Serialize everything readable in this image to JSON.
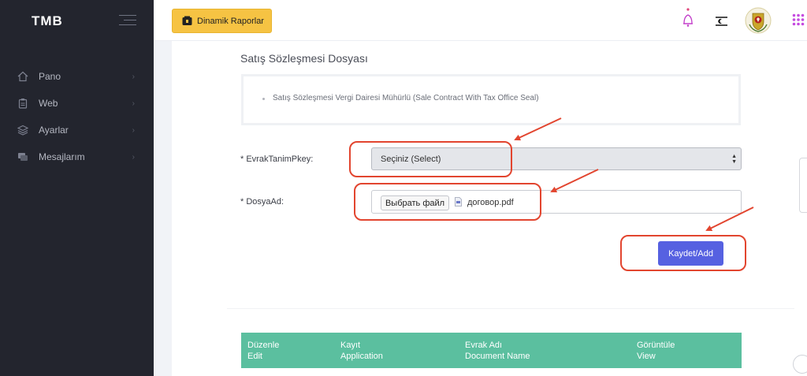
{
  "sidebar": {
    "logo": "TMB",
    "items": [
      {
        "label": "Pano",
        "icon": "home-icon"
      },
      {
        "label": "Web",
        "icon": "clipboard-icon"
      },
      {
        "label": "Ayarlar",
        "icon": "layers-icon"
      },
      {
        "label": "Mesajlarım",
        "icon": "chat-icon"
      }
    ]
  },
  "header": {
    "report_button": "Dinamik Raporlar",
    "icons": [
      "bell-icon",
      "flag-icon",
      "emblem-icon",
      "apps-grid-icon"
    ]
  },
  "form": {
    "section_title": "Satış Sözleşmesi Dosyası",
    "note": "Satış Sözleşmesi Vergi Dairesi Mühürlü (Sale Contract With Tax Office Seal)",
    "evrak_label": "* EvrakTanimPkey:",
    "select_value": "Seçiniz (Select)",
    "dosya_label": "* DosyaAd:",
    "file_button": "Выбрать файл",
    "file_name": "договор.pdf",
    "submit": "Kaydet/Add"
  },
  "table": {
    "columns": [
      {
        "line1": "Düzenle",
        "line2": "Edit"
      },
      {
        "line1": "Kayıt",
        "line2": "Application"
      },
      {
        "line1": "Evrak Adı",
        "line2": "Document Name"
      },
      {
        "line1": "Görüntüle",
        "line2": "View"
      }
    ]
  },
  "colors": {
    "sidebar_bg": "#23252e",
    "accent": "#5661e1",
    "table_header": "#5bbf9f",
    "report_button": "#f6c343",
    "annotation": "#e2452f"
  }
}
